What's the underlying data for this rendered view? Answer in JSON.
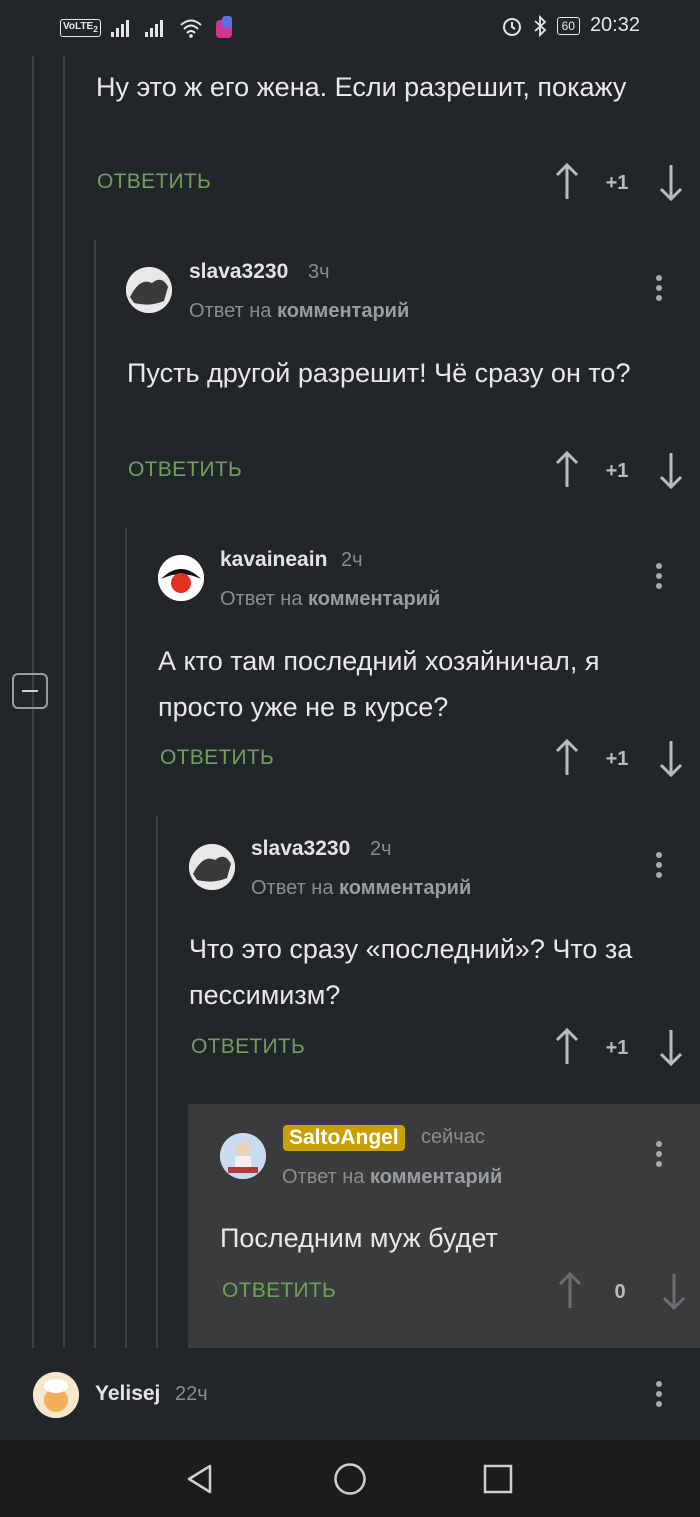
{
  "status_bar": {
    "volte": "VoLTE",
    "sim_num": "2",
    "battery": "60",
    "time": "20:32"
  },
  "colors": {
    "background": "#222529",
    "reply_green": "#6fa15a",
    "highlight_bg": "#3a3b3c",
    "badge_gold": "#c8a100"
  },
  "reply_label": "ОТВЕТИТЬ",
  "reply_to": {
    "prefix": "Ответ на",
    "target": "комментарий"
  },
  "comments": [
    {
      "username": "",
      "time": "",
      "text": "Ну это ж его жена. Если разрешит, покажу",
      "score": "+1"
    },
    {
      "username": "slava3230",
      "time": "3ч",
      "text": "Пусть другой разрешит! Чё сразу он то?",
      "score": "+1"
    },
    {
      "username": "kavaineain",
      "time": "2ч",
      "text": "А кто там последний хозяйничал, я просто уже не в курсе?",
      "score": "+1"
    },
    {
      "username": "slava3230",
      "time": "2ч",
      "text": "Что это сразу «последний»? Что за пессимизм?",
      "score": "+1"
    },
    {
      "username": "SaltoAngel",
      "time": "сейчас",
      "text": "Последним муж будет",
      "score": "0"
    }
  ],
  "next_comment": {
    "username": "Yelisej",
    "time": "22ч"
  },
  "icons": {
    "up": "arrow-up-icon",
    "down": "arrow-down-icon",
    "more": "more-vertical-icon",
    "collapse": "collapse-minus-icon",
    "nav_back": "back-triangle-icon",
    "nav_home": "home-circle-icon",
    "nav_recent": "recent-square-icon"
  }
}
